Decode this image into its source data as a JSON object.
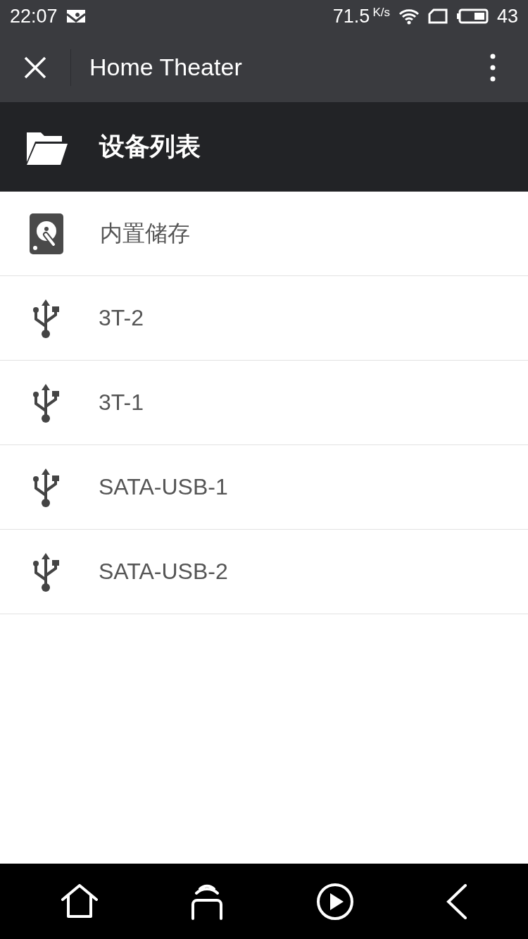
{
  "status_bar": {
    "time": "22:07",
    "speed": "71.5",
    "speed_unit": "K/s",
    "battery": "43"
  },
  "app_bar": {
    "title": "Home Theater"
  },
  "header": {
    "title": "设备列表"
  },
  "devices": [
    {
      "kind": "drive",
      "name": "内置储存"
    },
    {
      "kind": "usb",
      "name": "3T-2"
    },
    {
      "kind": "usb",
      "name": "3T-1"
    },
    {
      "kind": "usb",
      "name": "SATA-USB-1"
    },
    {
      "kind": "usb",
      "name": "SATA-USB-2"
    }
  ]
}
